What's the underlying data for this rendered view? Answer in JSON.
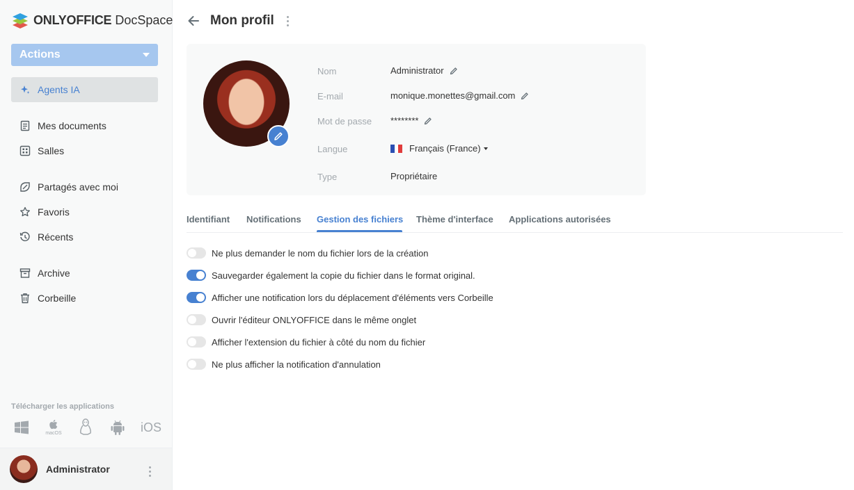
{
  "sidebar": {
    "logo_bold": "ONLYOFFICE",
    "logo_light": " DocSpace",
    "actions_label": "Actions",
    "items": [
      {
        "label": "Agents IA",
        "icon": "sparkle-icon"
      },
      {
        "label": "Mes documents",
        "icon": "document-icon"
      },
      {
        "label": "Salles",
        "icon": "rooms-icon"
      },
      {
        "label": "Partagés avec moi",
        "icon": "shared-icon"
      },
      {
        "label": "Favoris",
        "icon": "star-icon"
      },
      {
        "label": "Récents",
        "icon": "history-icon"
      },
      {
        "label": "Archive",
        "icon": "archive-icon"
      },
      {
        "label": "Corbeille",
        "icon": "trash-icon"
      }
    ],
    "download_title": "Télécharger les applications",
    "apps": {
      "macos": "macOS",
      "ios": "iOS"
    },
    "user_name": "Administrator"
  },
  "header": {
    "title": "Mon profil"
  },
  "profile": {
    "labels": {
      "name": "Nom",
      "email": "E-mail",
      "password": "Mot de passe",
      "language": "Langue",
      "type": "Type"
    },
    "values": {
      "name": "Administrator",
      "email": "monique.monettes@gmail.com",
      "password": "********",
      "language": "Français (France)",
      "type": "Propriétaire"
    }
  },
  "tabs": [
    {
      "label": "Identifiant"
    },
    {
      "label": "Notifications"
    },
    {
      "label": "Gestion des fichiers",
      "active": true
    },
    {
      "label": "Thème d'interface"
    },
    {
      "label": "Applications autorisées"
    }
  ],
  "settings": [
    {
      "label": "Ne plus demander le nom du fichier lors de la création",
      "enabled": false
    },
    {
      "label": "Sauvegarder également la copie du fichier dans le format original.",
      "enabled": true
    },
    {
      "label": "Afficher une notification lors du déplacement d'éléments vers Corbeille",
      "enabled": true
    },
    {
      "label": "Ouvrir l'éditeur ONLYOFFICE dans le même onglet",
      "enabled": false
    },
    {
      "label": "Afficher l'extension du fichier à côté du nom du fichier",
      "enabled": false
    },
    {
      "label": "Ne plus afficher la notification d'annulation",
      "enabled": false
    }
  ],
  "colors": {
    "accent": "#4781d1",
    "actions_button": "#a6c7ef"
  }
}
